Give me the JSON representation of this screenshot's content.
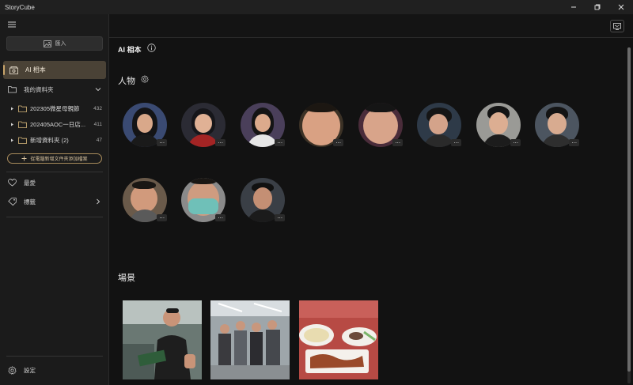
{
  "app": {
    "title": "StoryCube"
  },
  "sidebar": {
    "import_label": "匯入",
    "ai_album_label": "AI 相本",
    "my_library_label": "我的資料夾",
    "folders": [
      {
        "name": "202305微星母親節",
        "count": "432"
      },
      {
        "name": "202405AOC一日店...",
        "count": "411"
      },
      {
        "name": "新增資料夾 (2)",
        "count": "47"
      }
    ],
    "add_folder_label": "從電腦新增文件夾添加檔案",
    "favorites_label": "最愛",
    "tags_label": "標籤",
    "settings_label": "設定"
  },
  "main": {
    "title": "AI 相本",
    "people_section": "人物",
    "scenes_section": "場景",
    "more_label": "···"
  },
  "colors": {
    "accent": "#c9a56a",
    "selected_bg": "#4a4236",
    "main_bg": "#121212",
    "sidebar_bg": "#1b1b1b"
  },
  "icons": [
    "hamburger-icon",
    "image-icon",
    "album-icon",
    "folder-icon",
    "chevron-down-icon",
    "chevron-right-icon",
    "triangle-right-icon",
    "plus-icon",
    "heart-icon",
    "tag-icon",
    "gear-icon",
    "info-icon",
    "slideshow-icon",
    "minimize-icon",
    "restore-icon",
    "close-icon"
  ]
}
